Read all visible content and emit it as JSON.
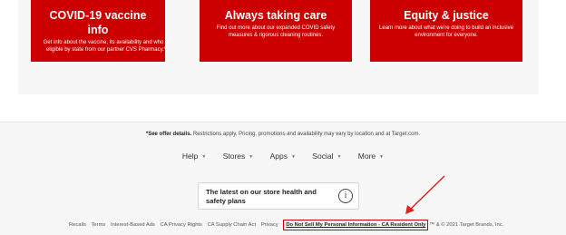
{
  "cards": [
    {
      "title": "COVID-19 vaccine info",
      "text": "Get info about the vaccine, its availability and who is eligible by state from our partner CVS Pharmacy.*"
    },
    {
      "title": "Always taking care",
      "text": "Find out more about our expanded COVID safety measures & rigorous cleaning routines."
    },
    {
      "title": "Equity & justice",
      "text": "Learn more about what we're doing to build an inclusive environment for everyone."
    }
  ],
  "disclaimer": {
    "bold": "*See offer details.",
    "rest": " Restrictions apply. Pricing, promotions and availability may vary by location and at Target.com."
  },
  "nav": [
    "Help",
    "Stores",
    "Apps",
    "Social",
    "More"
  ],
  "notice": {
    "text": "The latest on our store health and safety plans",
    "icon": "info-icon"
  },
  "footer_links": [
    "Recalls",
    "Terms",
    "Interest-Based Ads",
    "CA Privacy Rights",
    "CA Supply Chain Act",
    "Privacy"
  ],
  "do_not_sell": "Do Not Sell My Personal Information - CA Resident Only",
  "copyright": "™ & © 2021 Target Brands, Inc.",
  "colors": {
    "accent": "#cc0000",
    "panel": "#f7f7f7"
  }
}
